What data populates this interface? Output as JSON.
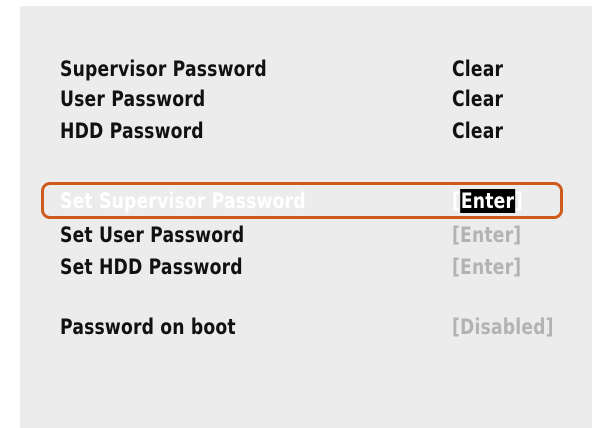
{
  "rows": [
    {
      "label": "Supervisor Password",
      "value": "Clear"
    },
    {
      "label": "User Password",
      "value": "Clear"
    },
    {
      "label": "HDD Password",
      "value": "Clear"
    },
    {
      "label": "Set Supervisor Password",
      "value_open": "[",
      "value_core": "Enter",
      "value_close": "]"
    },
    {
      "label": "Set User Password",
      "value": "[Enter]"
    },
    {
      "label": "Set HDD Password",
      "value": "[Enter]"
    },
    {
      "label": "Password on boot",
      "value": "[Disabled]"
    }
  ],
  "colors": {
    "background": "#ececec",
    "text": "#111111",
    "disabled_text": "#b3b3b3",
    "selection_frame": "#cf5a1e"
  }
}
